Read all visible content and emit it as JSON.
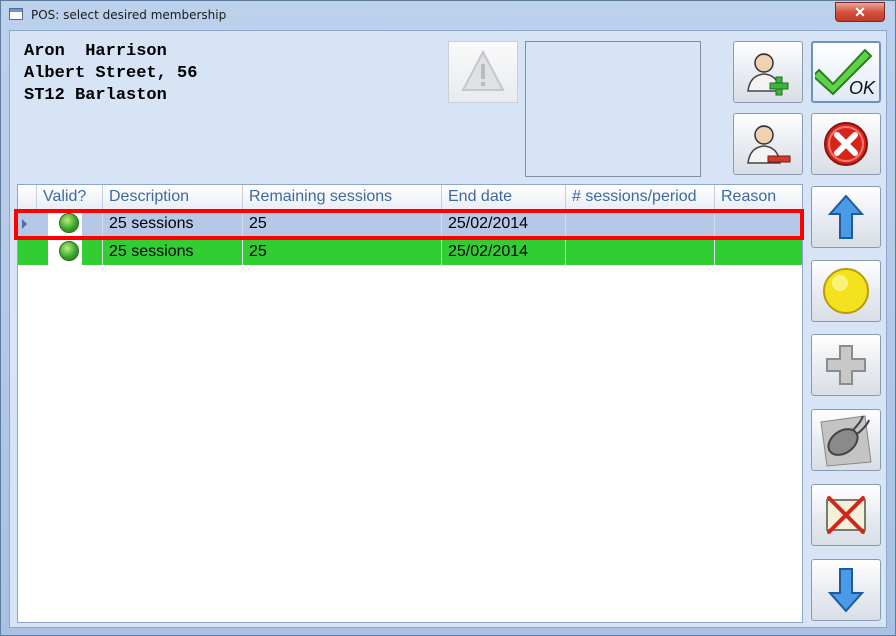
{
  "window": {
    "title": "POS: select desired membership",
    "close_label": "✕"
  },
  "customer": {
    "name_line": "Aron  Harrison",
    "address_line": "Albert Street, 56",
    "city_line": "ST12 Barlaston"
  },
  "colors": {
    "selected_row": "#b6c8e8",
    "valid_row": "#32cd32",
    "selection_outline": "#ff0000",
    "header_text": "#3c6aa1"
  },
  "toolbar_icons": {
    "warning": "warning-icon",
    "add_customer": "add-user-icon",
    "remove_customer": "remove-user-icon",
    "ok": "ok-checkmark-icon",
    "cancel": "cancel-icon",
    "up": "arrow-up-icon",
    "yellow": "yellow-circle-icon",
    "add": "plus-icon",
    "satellite": "satellite-dish-icon",
    "delete": "delete-cross-icon",
    "down": "arrow-down-icon"
  },
  "ok_label": "OK",
  "grid": {
    "columns": [
      "Valid?",
      "Description",
      "Remaining sessions",
      "End date",
      "# sessions/period",
      "Reason"
    ],
    "rows": [
      {
        "valid": true,
        "description": "25 sessions",
        "remaining": "25",
        "end_date": "25/02/2014",
        "sessions_period": "",
        "reason": "",
        "selected": true
      },
      {
        "valid": true,
        "description": "25 sessions",
        "remaining": "25",
        "end_date": "25/02/2014",
        "sessions_period": "",
        "reason": "",
        "selected": false
      }
    ]
  }
}
